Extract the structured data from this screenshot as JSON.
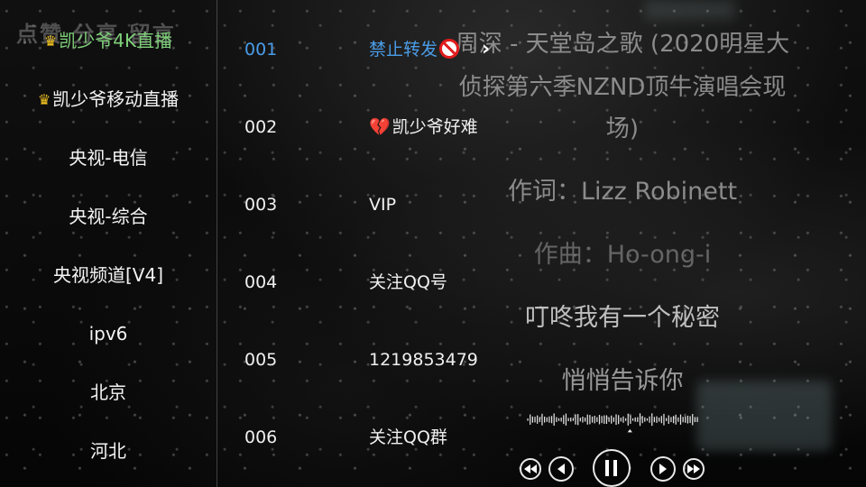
{
  "background": {
    "watermark": "点赞 分享 留言",
    "lyrics": [
      "周深 - 天堂岛之歌 (2020明星大",
      "侦探第六季NZND顶牛演唱会现",
      "场)",
      "作词：Lizz Robinett",
      "作曲：Ho-ong-i",
      "叮咚我有一个秘密",
      "悄悄告诉你"
    ]
  },
  "sidebar": {
    "items": [
      {
        "label": "凯少爷4K直播",
        "crown": true,
        "active": true
      },
      {
        "label": "凯少爷移动直播",
        "crown": true,
        "active": false
      },
      {
        "label": "央视-电信",
        "crown": false,
        "active": false
      },
      {
        "label": "央视-综合",
        "crown": false,
        "active": false
      },
      {
        "label": "央视频道[V4]",
        "crown": false,
        "active": false
      },
      {
        "label": "ipv6",
        "crown": false,
        "active": false
      },
      {
        "label": "北京",
        "crown": false,
        "active": false
      },
      {
        "label": "河北",
        "crown": false,
        "active": false
      }
    ]
  },
  "channels": [
    {
      "number": "001",
      "name": "禁止转发",
      "active": true
    },
    {
      "number": "002",
      "name": "凯少爷好难",
      "active": false
    },
    {
      "number": "003",
      "name": "VIP",
      "active": false
    },
    {
      "number": "004",
      "name": "关注QQ号",
      "active": false
    },
    {
      "number": "005",
      "name": "1219853479",
      "active": false
    },
    {
      "number": "006",
      "name": "关注QQ群",
      "active": false
    }
  ],
  "icons": {
    "crown": "crown-icon",
    "prohibited": "prohibited-icon",
    "broken_heart": "broken-heart-icon",
    "chevron": "chevron-right-icon",
    "rewind": "rewind-icon",
    "previous": "previous-icon",
    "pause": "pause-icon",
    "next": "next-icon",
    "fast_forward": "fast-forward-icon"
  },
  "colors": {
    "active_sidebar": "#7fd07a",
    "active_channel": "#4a9ce8",
    "crown": "#f3c320",
    "prohibited": "#e11d1d",
    "broken_heart": "#d8233a"
  }
}
